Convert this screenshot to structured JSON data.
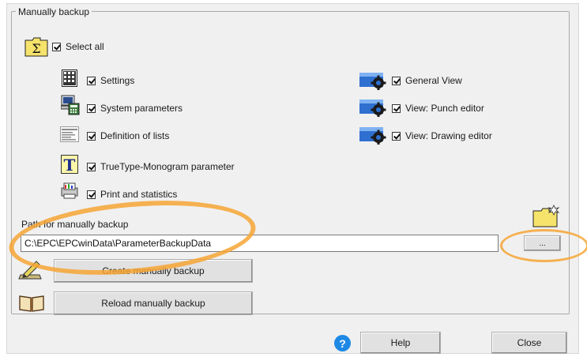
{
  "group": {
    "title": "Manually backup"
  },
  "select_all": {
    "label": "Select all",
    "checked": true
  },
  "left_items": [
    {
      "label": "Settings",
      "checked": true,
      "icon": "settings-grid-icon"
    },
    {
      "label": "System parameters",
      "checked": true,
      "icon": "computer-calculator-icon"
    },
    {
      "label": "Definition of lists",
      "checked": true,
      "icon": "list-document-icon"
    },
    {
      "label": "TrueType-Monogram parameter",
      "checked": true,
      "icon": "truetype-font-icon"
    },
    {
      "label": "Print and statistics",
      "checked": true,
      "icon": "print-statistics-icon"
    }
  ],
  "right_items": [
    {
      "label": "General View",
      "checked": true,
      "icon": "view-gear-icon"
    },
    {
      "label": "View: Punch editor",
      "checked": true,
      "icon": "view-gear-icon"
    },
    {
      "label": "View: Drawing editor",
      "checked": true,
      "icon": "view-gear-icon"
    }
  ],
  "path": {
    "label": "Path for manually backup",
    "value": "C:\\EPC\\EPCwinData\\ParameterBackupData",
    "browse_label": "..."
  },
  "buttons": {
    "create": "Create manually backup",
    "reload": "Reload manually backup",
    "help": "Help",
    "close": "Close"
  },
  "help_icon_glyph": "?",
  "colors": {
    "annotation": "#f6a534",
    "help_blue": "#1e88e5",
    "folder_yellow": "#f5e36b"
  }
}
